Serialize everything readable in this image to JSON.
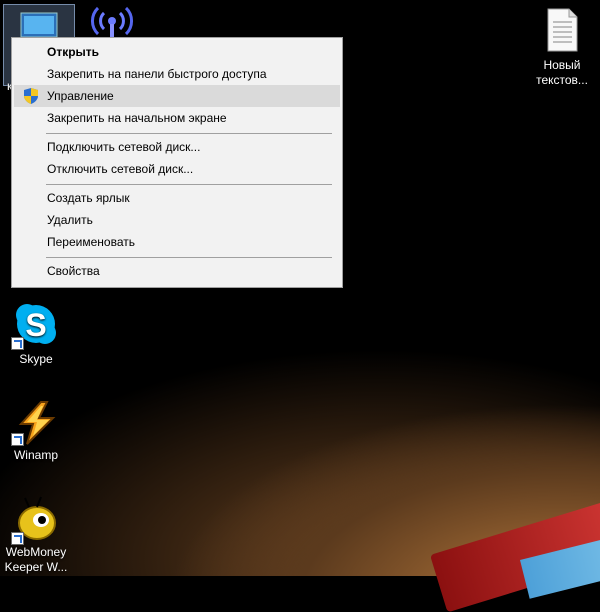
{
  "desktop": {
    "icons": [
      {
        "label": "Skype"
      },
      {
        "label": "Winamp"
      },
      {
        "label": "WebMoney Keeper W..."
      },
      {
        "label": "Новый текстов..."
      },
      {
        "label": "к"
      }
    ]
  },
  "context_menu": {
    "items": [
      {
        "label": "Открыть"
      },
      {
        "label": "Закрепить на панели быстрого доступа"
      },
      {
        "label": "Управление"
      },
      {
        "label": "Закрепить на начальном экране"
      },
      {
        "label": "Подключить сетевой диск..."
      },
      {
        "label": "Отключить сетевой диск..."
      },
      {
        "label": "Создать ярлык"
      },
      {
        "label": "Удалить"
      },
      {
        "label": "Переименовать"
      },
      {
        "label": "Свойства"
      }
    ]
  },
  "colors": {
    "menu_bg": "#f2f2f2",
    "menu_hover": "#dadada",
    "skype_blue": "#00aff0",
    "winamp_orange": "#f7a21b"
  },
  "icons": [
    "computer-icon",
    "network-icon",
    "text-document-icon",
    "skype-icon",
    "winamp-icon",
    "webmoney-icon",
    "shield-icon",
    "shortcut-arrow-icon"
  ]
}
